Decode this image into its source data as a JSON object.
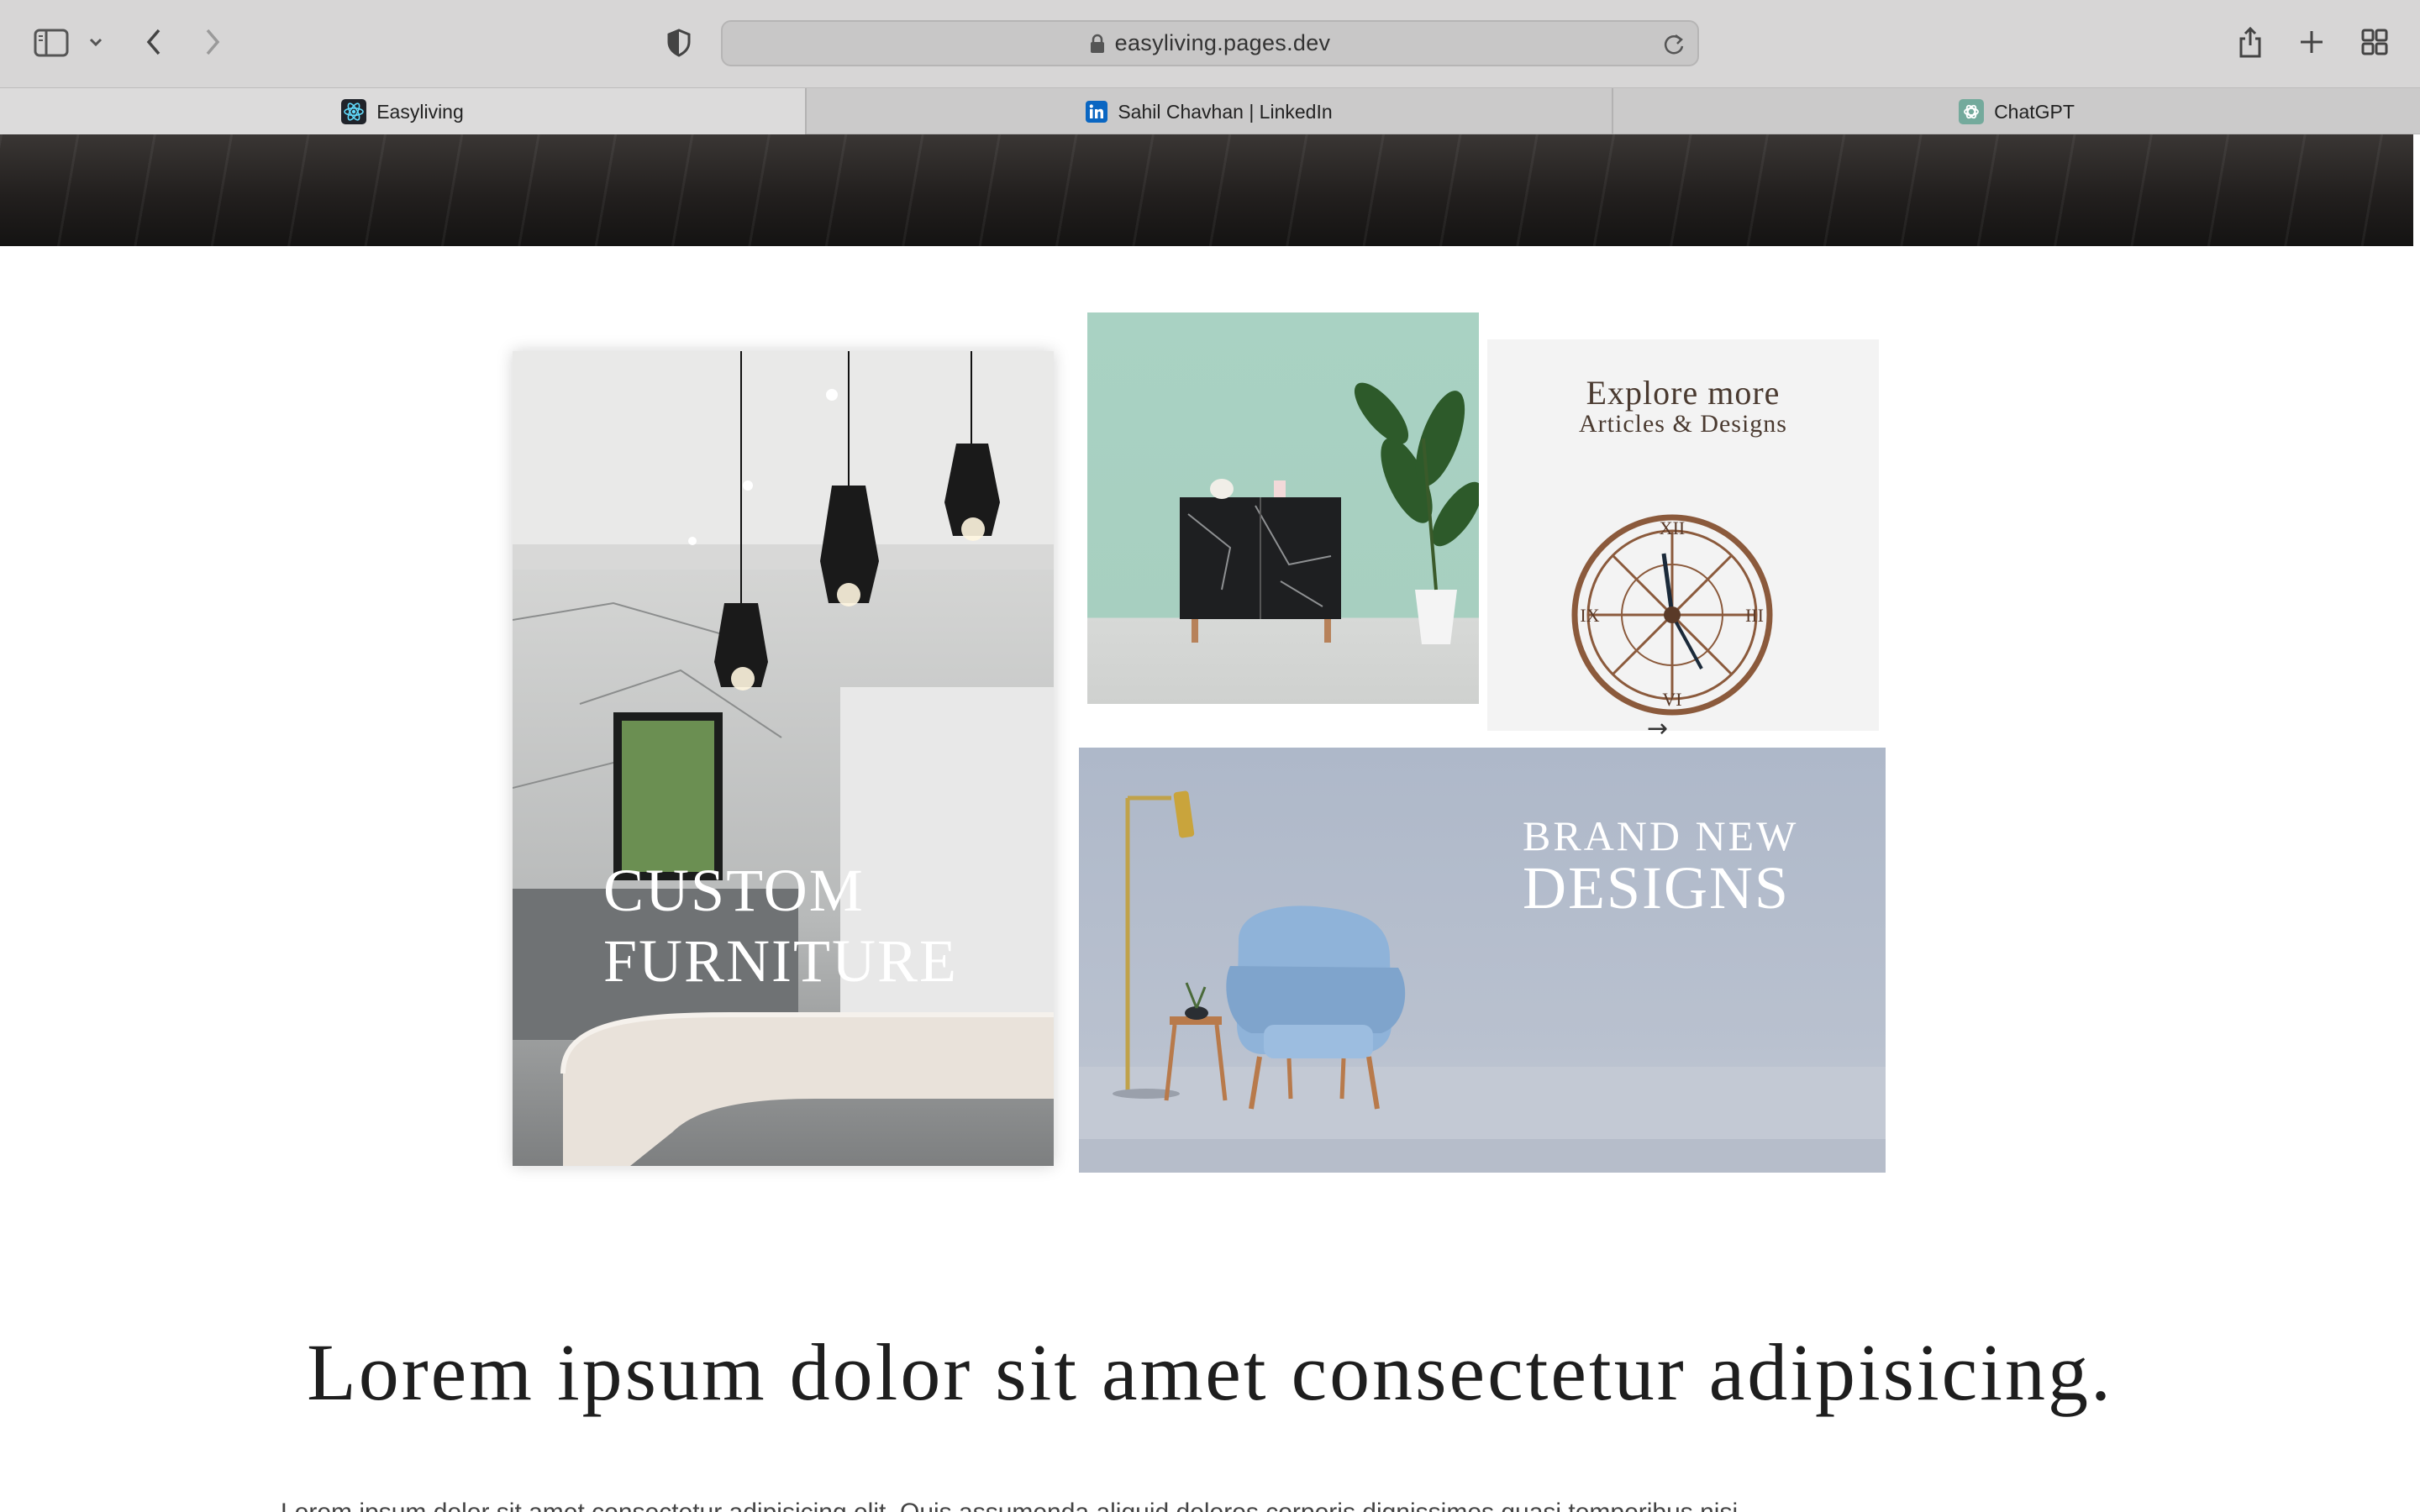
{
  "browser": {
    "url": "easyliving.pages.dev",
    "tabs": [
      {
        "label": "Easyliving",
        "icon": "react-icon",
        "active": true
      },
      {
        "label": "Sahil Chavhan | LinkedIn",
        "icon": "linkedin-icon",
        "active": false
      },
      {
        "label": "ChatGPT",
        "icon": "chatgpt-icon",
        "active": false
      }
    ],
    "colors": {
      "linkedin": "#0a66c2",
      "react": "#61dafb",
      "chatgpt": "#74aa9c"
    }
  },
  "gallery": {
    "custom_furniture": {
      "line1": "CUSTOM",
      "line2": "FURNITURE"
    },
    "explore": {
      "title": "Explore more",
      "subtitle": "Articles & Designs",
      "arrow": "→"
    },
    "brand_new": {
      "line1": "BRAND NEW",
      "line2": "DESIGNS"
    }
  },
  "section": {
    "headline": "Lorem ipsum dolor sit amet consectetur adipisicing.",
    "paragraph": "Lorem ipsum dolor sit amet consectetur adipisicing elit. Quis assumenda aliquid dolores corporis dignissimos quasi temporibus nisi.",
    "paragraph_partially_visible": true
  }
}
